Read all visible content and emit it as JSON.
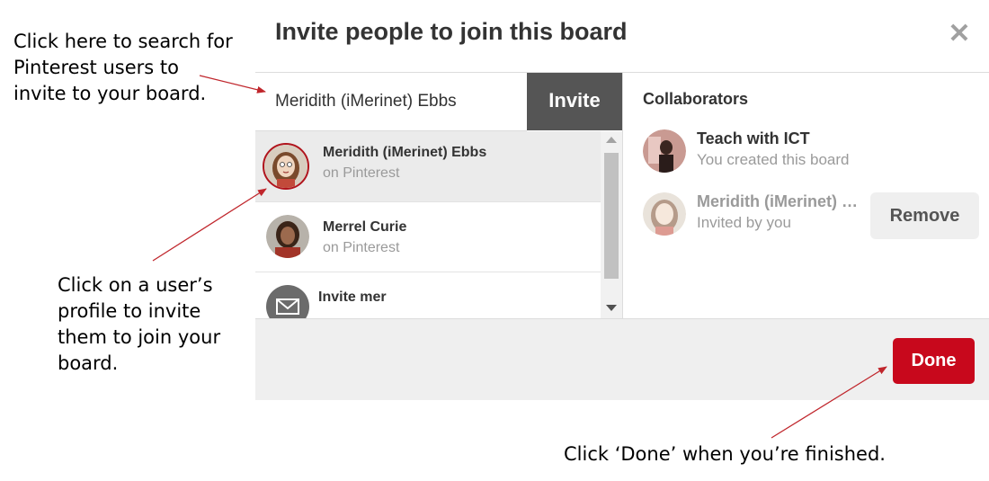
{
  "annotations": {
    "search_hint": "Click here to search for Pinterest users to invite to your board.",
    "profile_hint": "Click on a user’s profile to invite them to join your board.",
    "done_hint": "Click ‘Done’ when you’re finished."
  },
  "modal": {
    "title": "Invite people to join this board",
    "close_icon": "close-icon"
  },
  "search": {
    "value": "Meridith (iMerinet) Ebbs",
    "invite_label": "Invite"
  },
  "results": [
    {
      "name": "Meridith (iMerinet) Ebbs",
      "subtitle": "on Pinterest",
      "selected": true
    },
    {
      "name": "Merrel Curie",
      "subtitle": "on Pinterest",
      "selected": false
    },
    {
      "name": "Invite mer",
      "subtitle": "",
      "icon": "mail-icon",
      "selected": false
    }
  ],
  "collaborators": {
    "heading": "Collaborators",
    "items": [
      {
        "name": "Teach with ICT",
        "subtitle": "You created this board"
      },
      {
        "name": "Meridith (iMerinet) Ebbs",
        "subtitle": "Invited by you",
        "action": "Remove"
      }
    ]
  },
  "footer": {
    "done_label": "Done"
  },
  "colors": {
    "done_button": "#c8081c",
    "invite_button": "#555555",
    "annotation_arrow": "#c0262c"
  }
}
